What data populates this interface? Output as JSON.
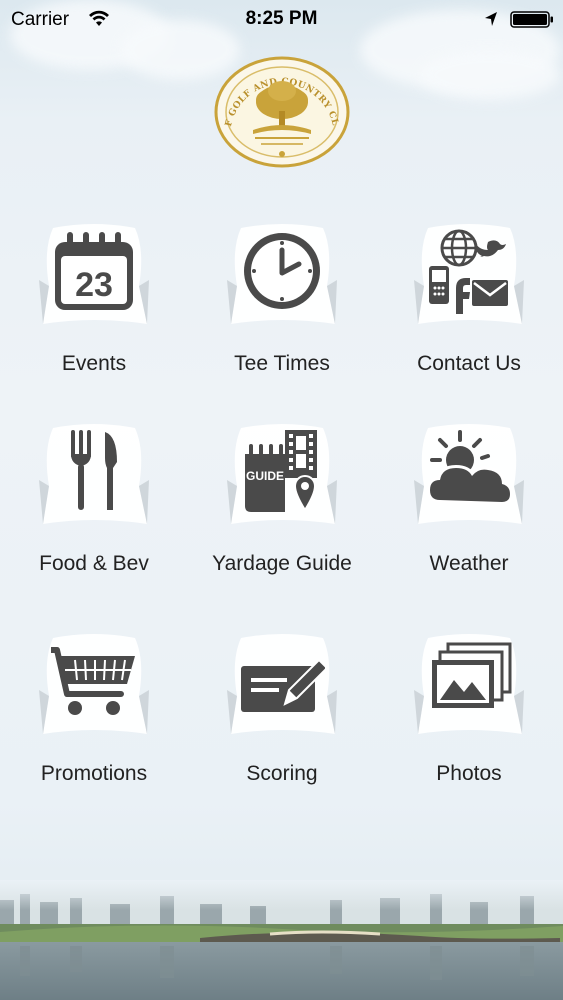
{
  "status_bar": {
    "carrier": "Carrier",
    "time": "8:25 PM"
  },
  "logo": {
    "text": "DLF GOLF AND COUNTRY CLUB",
    "color": "#c9a33a"
  },
  "calendar_day": "23",
  "guide_text": "GUIDE",
  "tiles": [
    {
      "label": "Events",
      "icon": "calendar-icon"
    },
    {
      "label": "Tee Times",
      "icon": "clock-icon"
    },
    {
      "label": "Contact Us",
      "icon": "contact-icon"
    },
    {
      "label": "Food & Bev",
      "icon": "fork-knife-icon"
    },
    {
      "label": "Yardage Guide",
      "icon": "guide-icon"
    },
    {
      "label": "Weather",
      "icon": "weather-icon"
    },
    {
      "label": "Promotions",
      "icon": "cart-icon"
    },
    {
      "label": "Scoring",
      "icon": "scorecard-icon"
    },
    {
      "label": "Photos",
      "icon": "photos-icon"
    }
  ],
  "colors": {
    "icon": "#4a4a4a",
    "icon_bg": "#ffffff",
    "text": "#222222"
  }
}
